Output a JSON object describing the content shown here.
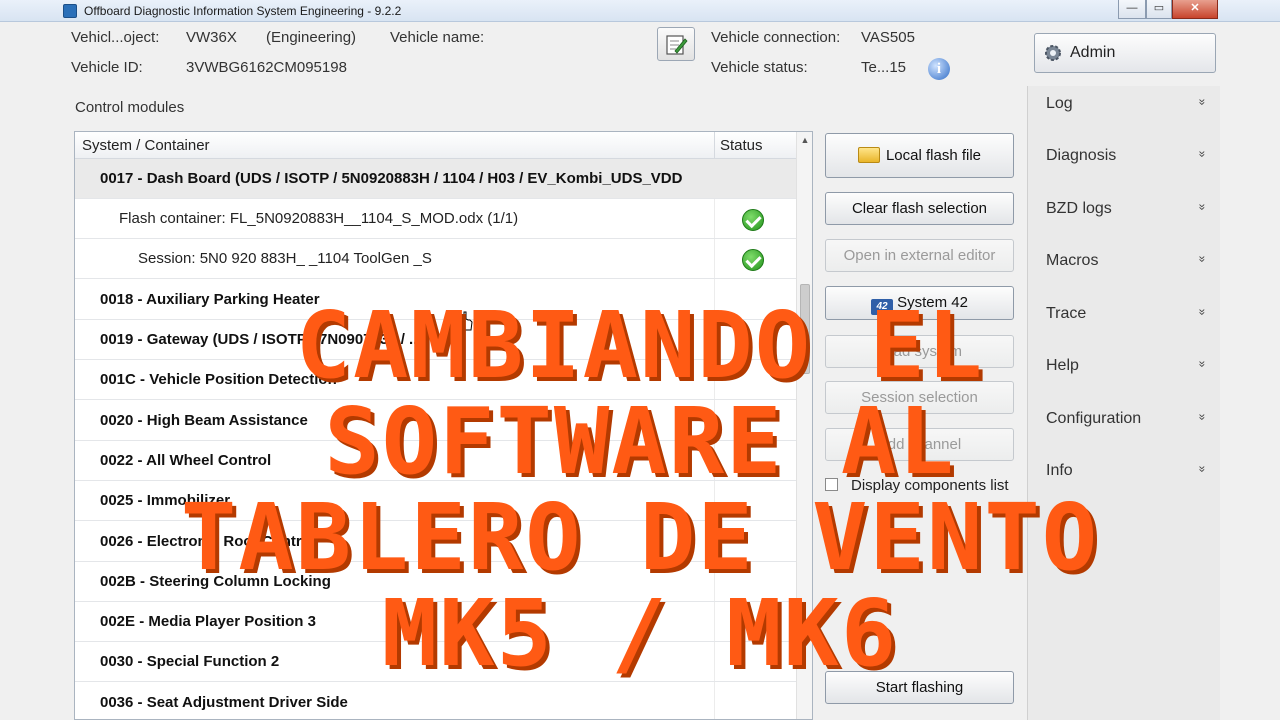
{
  "window": {
    "title": "Offboard Diagnostic Information System Engineering - 9.2.2",
    "min_label": "—",
    "max_label": "▭",
    "close_label": "✕"
  },
  "vehicle": {
    "project_label": "Vehicl...oject:",
    "project_value": "VW36X",
    "project_mode": "(Engineering)",
    "name_label": "Vehicle name:",
    "id_label": "Vehicle ID:",
    "id_value": "3VWBG6162CM095198",
    "connection_label": "Vehicle connection:",
    "connection_value": "VAS505",
    "status_label": "Vehicle status:",
    "status_value": "Te...15",
    "info_glyph": "i"
  },
  "admin": {
    "label": "Admin"
  },
  "control_modules": {
    "title": "Control modules",
    "headers": {
      "system": "System / Container",
      "status": "Status"
    },
    "rows": [
      {
        "text": "0017 - Dash Board  (UDS / ISOTP / 5N0920883H / 1104 / H03 / EV_Kombi_UDS_VDD"
      },
      {
        "text": "Flash container: FL_5N0920883H__1104_S_MOD.odx (1/1)"
      },
      {
        "text": "Session: 5N0 920 883H_ _1104 ToolGen _S"
      },
      {
        "text": "0018 - Auxiliary Parking Heater"
      },
      {
        "text": "0019 - Gateway  (UDS / ISOTP / 7N0907530 / ..."
      },
      {
        "text": "001C - Vehicle Position Detection"
      },
      {
        "text": "0020 - High Beam Assistance"
      },
      {
        "text": "0022 - All Wheel Control"
      },
      {
        "text": "0025 - Immobilizer"
      },
      {
        "text": "0026 - Electronic Roof Control"
      },
      {
        "text": "002B - Steering Column Locking"
      },
      {
        "text": "002E - Media Player Position 3"
      },
      {
        "text": "0030 - Special Function 2"
      },
      {
        "text": "0036 - Seat Adjustment Driver Side"
      }
    ]
  },
  "actions": {
    "local_flash": "Local flash file",
    "clear_flash": "Clear flash selection",
    "open_external": "Open in external editor",
    "system42": "System 42",
    "system42_icon": "42",
    "load_system": "Load system",
    "session_selection": "Session selection",
    "add_channel": "Add channel",
    "display_components": "Display components list",
    "start_flashing": "Start flashing"
  },
  "menu": {
    "items": [
      "Log",
      "Diagnosis",
      "BZD logs",
      "Macros",
      "Trace",
      "Help",
      "Configuration",
      "Info"
    ],
    "chevron": "»"
  },
  "overlay": {
    "line1": "CAMBIANDO EL",
    "line2": "SOFTWARE AL",
    "line3": "TABLERO DE VENTO",
    "line4": "MK5 / MK6"
  }
}
